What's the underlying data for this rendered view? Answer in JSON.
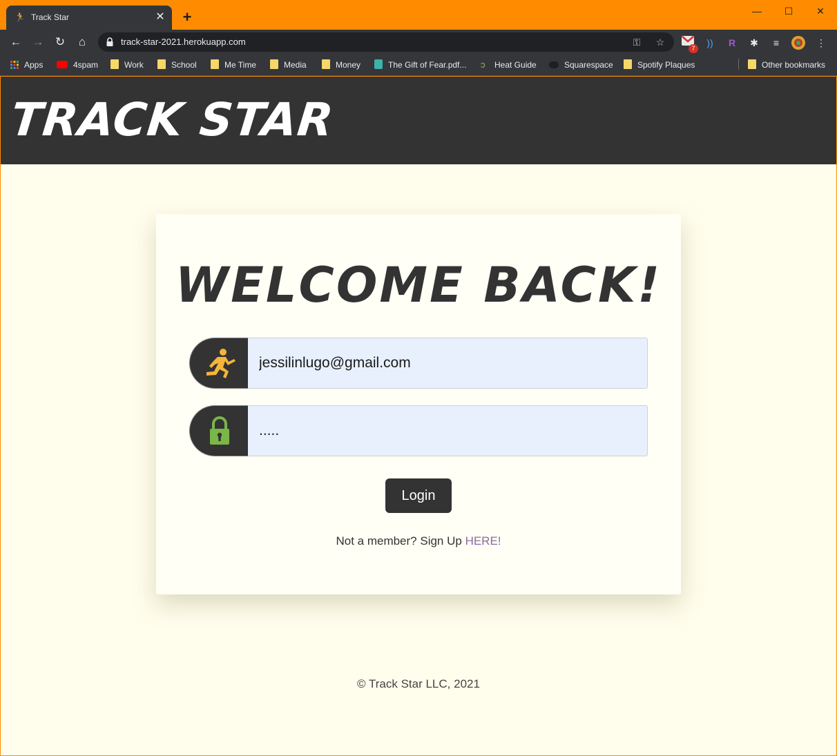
{
  "browser": {
    "tab_title": "Track Star",
    "tab_close": "✕",
    "new_tab": "+",
    "url": "track-star-2021.herokuapp.com",
    "window_controls": {
      "minimize": "—",
      "maximize": "☐",
      "close": "✕"
    },
    "gmail_badge": "7",
    "bookmarks": [
      {
        "label": "Apps",
        "icon": "apps-grid-icon"
      },
      {
        "label": "4spam",
        "icon": "youtube-icon"
      },
      {
        "label": "Work",
        "icon": "folder-icon"
      },
      {
        "label": "School",
        "icon": "folder-icon"
      },
      {
        "label": "Me Time",
        "icon": "folder-icon"
      },
      {
        "label": "Media",
        "icon": "folder-icon"
      },
      {
        "label": "Money",
        "icon": "folder-icon"
      },
      {
        "label": "The Gift of Fear.pdf...",
        "icon": "robot-icon"
      },
      {
        "label": "Heat Guide",
        "icon": "leaf-icon"
      },
      {
        "label": "Squarespace",
        "icon": "squarespace-icon"
      },
      {
        "label": "Spotify Plaques",
        "icon": "folder-icon"
      }
    ],
    "other_bookmarks": "Other bookmarks"
  },
  "site": {
    "brand": "TRACK STAR",
    "heading": "WELCOME BACK!",
    "email_value": "jessilinlugo@gmail.com",
    "password_value": ".....",
    "login_label": "Login",
    "signup_prefix": "Not a member? Sign Up ",
    "signup_link": "HERE!",
    "footer": "© Track Star LLC, 2021"
  },
  "colors": {
    "browser_frame": "#ff8c00",
    "header_bg": "#333333",
    "page_bg": "#fffdec",
    "input_bg": "#e8f0fe",
    "runner_icon": "#f5b43a",
    "lock_icon": "#7ab648",
    "link": "#8a6a9f"
  }
}
